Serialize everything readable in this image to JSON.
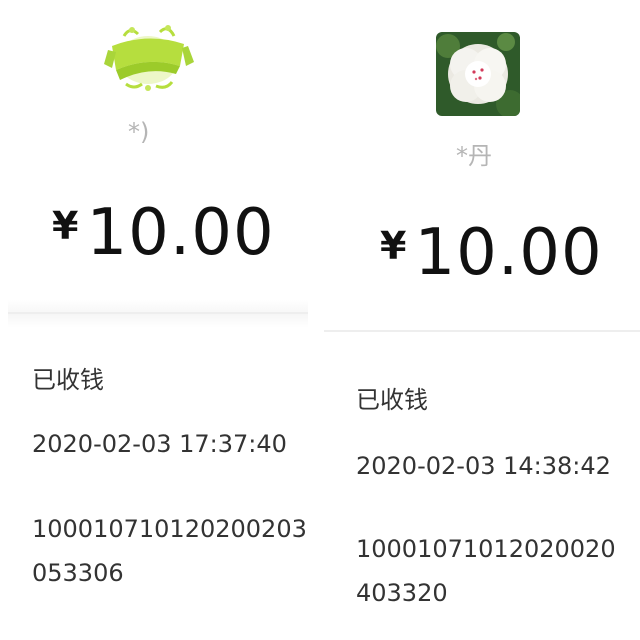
{
  "left": {
    "name": "*)",
    "amount": {
      "currency": "¥",
      "value": "10.00"
    },
    "status": "已收钱",
    "time": "2020-02-03 17:37:40",
    "order_line1": "100010710120200203",
    "order_line2": "053306"
  },
  "right": {
    "name": "*丹",
    "amount": {
      "currency": "¥",
      "value": "10.00"
    },
    "status": "已收钱",
    "time": "2020-02-03 14:38:42",
    "order_line1": "10001071012020020",
    "order_line2": "403320"
  },
  "colors": {
    "avatar_left": "#b6de3e",
    "avatar_right_bg": "#2f5a2a",
    "flower": "#f4f3ef",
    "name": "#b5b5b5",
    "amount": "#111111",
    "text": "#333333"
  },
  "icons": {
    "left_avatar": "green-ribbon-emblem-icon",
    "right_avatar": "white-peony-flower-icon"
  }
}
